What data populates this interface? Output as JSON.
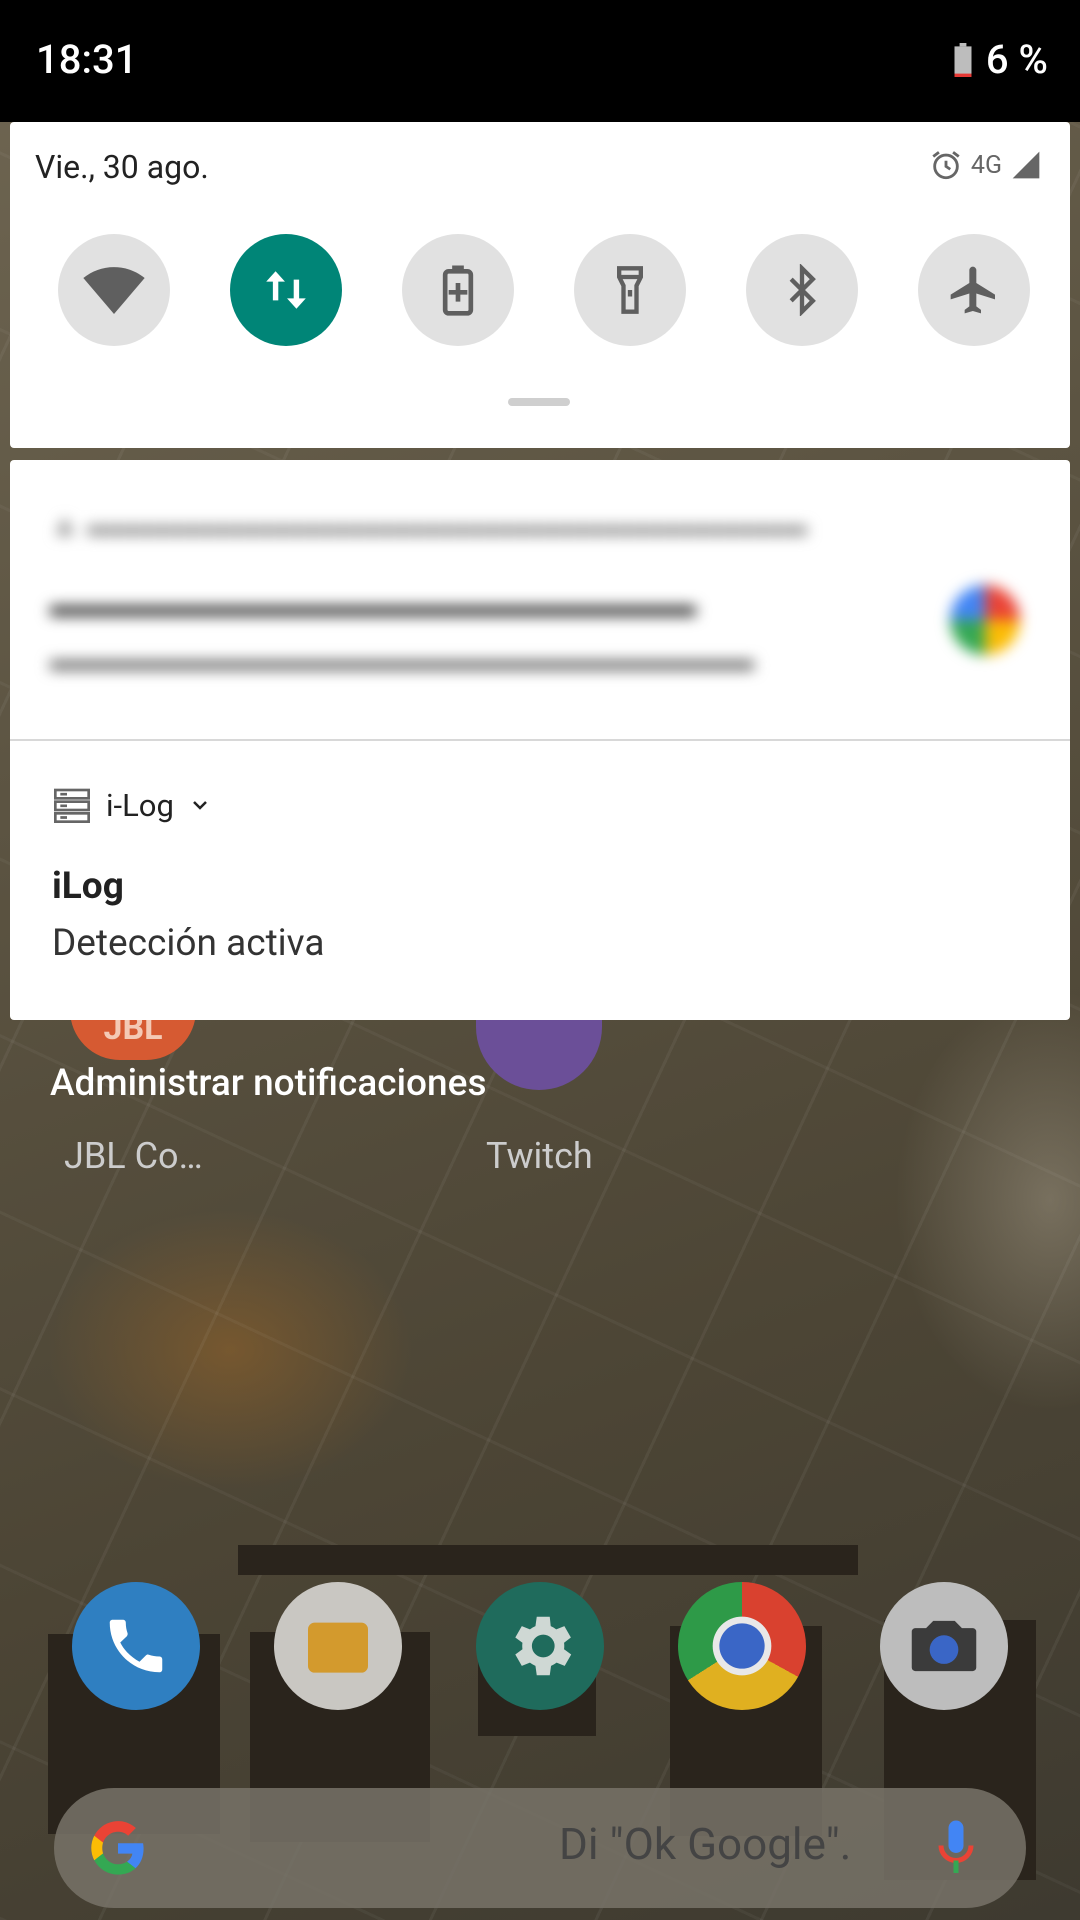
{
  "status_bar": {
    "time": "18:31",
    "battery_percent": "6 %",
    "battery_level": 6,
    "icons": [
      "battery-low-icon"
    ]
  },
  "quick_settings": {
    "date": "Vie., 30 ago.",
    "network": "4G",
    "status_icons": [
      "alarm-icon",
      "cell-signal-icon"
    ],
    "tiles": [
      {
        "name": "wifi",
        "icon": "wifi-icon",
        "active": false
      },
      {
        "name": "mobile-data",
        "icon": "data-arrows-icon",
        "active": true
      },
      {
        "name": "battery-saver",
        "icon": "battery-saver-icon",
        "active": false
      },
      {
        "name": "flashlight",
        "icon": "flashlight-icon",
        "active": false
      },
      {
        "name": "bluetooth",
        "icon": "bluetooth-icon",
        "active": false
      },
      {
        "name": "airplane-mode",
        "icon": "airplane-icon",
        "active": false
      }
    ],
    "accent_color": "#008577"
  },
  "notifications": {
    "app_name": "i-Log",
    "title": "iLog",
    "text": "Detección activa"
  },
  "manage_label": "Administrar notificaciones",
  "home": {
    "apps": [
      {
        "label": "JBL Co…",
        "icon": "jbl-icon"
      },
      {
        "label": "Twitch",
        "icon": "twitch-icon"
      }
    ],
    "dock": [
      "phone-icon",
      "files-icon",
      "settings-icon",
      "chrome-icon",
      "camera-icon"
    ],
    "search_hint": "Di \"Ok Google\"."
  }
}
